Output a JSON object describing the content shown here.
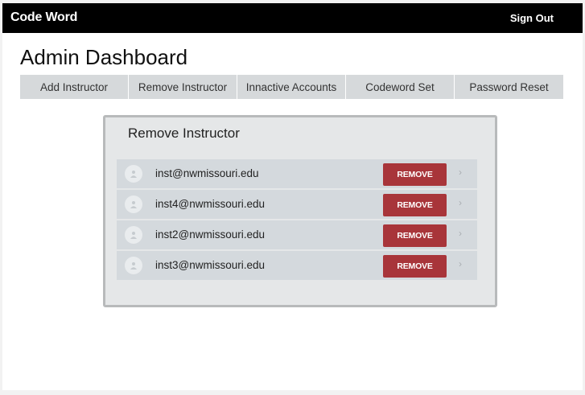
{
  "header": {
    "brand": "Code Word",
    "sign_out": "Sign Out"
  },
  "page": {
    "title": "Admin Dashboard"
  },
  "tabs": [
    {
      "label": "Add Instructor"
    },
    {
      "label": "Remove Instructor"
    },
    {
      "label": "Innactive Accounts"
    },
    {
      "label": "Codeword Set"
    },
    {
      "label": "Password Reset"
    }
  ],
  "panel": {
    "title": "Remove Instructor",
    "remove_label": "REMOVE",
    "instructors": [
      {
        "email": "inst@nwmissouri.edu"
      },
      {
        "email": "inst4@nwmissouri.edu"
      },
      {
        "email": "inst2@nwmissouri.edu"
      },
      {
        "email": "inst3@nwmissouri.edu"
      }
    ]
  },
  "colors": {
    "topbar": "#000000",
    "tab_bg": "#d6d9db",
    "panel_bg": "#e5e7e8",
    "row_bg": "#d4d9dd",
    "remove_button": "#a8353a"
  },
  "icons": {
    "avatar": "person-icon",
    "row_action": "chevron-right-icon"
  }
}
